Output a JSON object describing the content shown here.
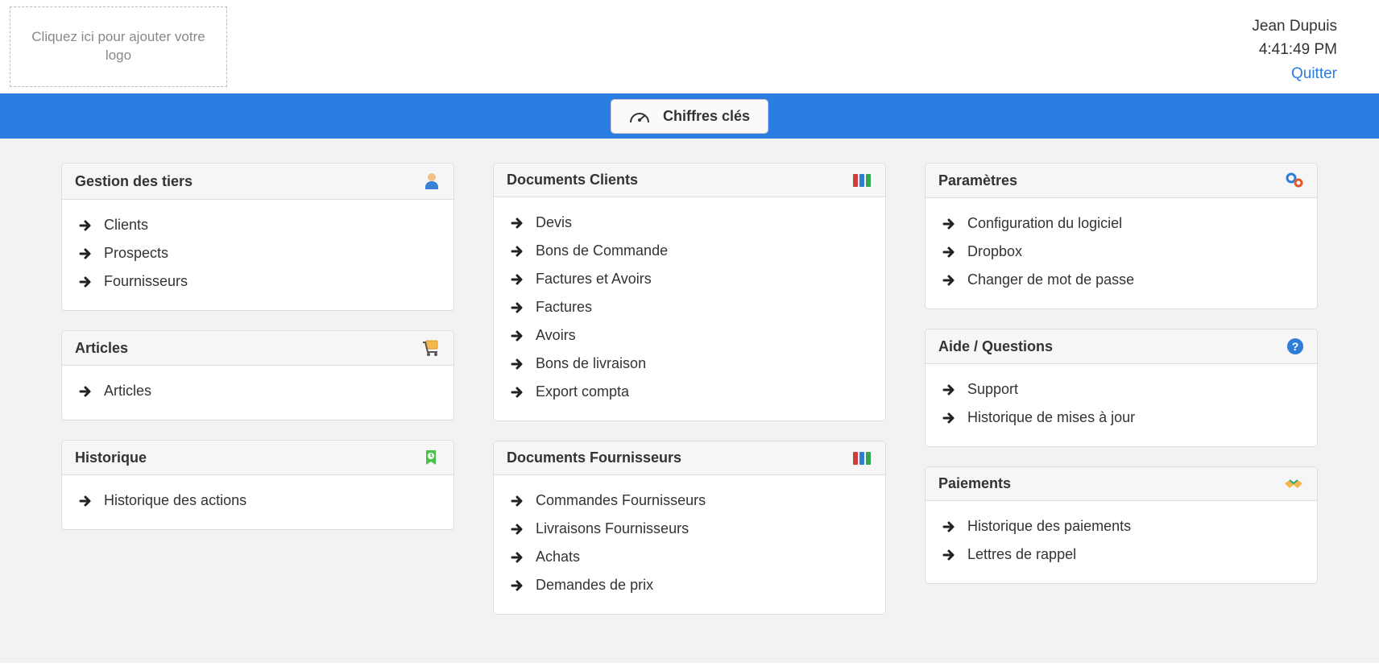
{
  "header": {
    "logo_placeholder": "Cliquez ici pour ajouter votre logo",
    "user_name": "Jean Dupuis",
    "time": "4:41:49 PM",
    "quit": "Quitter"
  },
  "bluebar": {
    "key_figures": "Chiffres clés"
  },
  "panels": {
    "tiers": {
      "title": "Gestion des tiers",
      "items": [
        "Clients",
        "Prospects",
        "Fournisseurs"
      ]
    },
    "articles": {
      "title": "Articles",
      "items": [
        "Articles"
      ]
    },
    "historique": {
      "title": "Historique",
      "items": [
        "Historique des actions"
      ]
    },
    "doc_clients": {
      "title": "Documents Clients",
      "items": [
        "Devis",
        "Bons de Commande",
        "Factures et Avoirs",
        "Factures",
        "Avoirs",
        "Bons de livraison",
        "Export compta"
      ]
    },
    "doc_fournisseurs": {
      "title": "Documents Fournisseurs",
      "items": [
        "Commandes Fournisseurs",
        "Livraisons Fournisseurs",
        "Achats",
        "Demandes de prix"
      ]
    },
    "parametres": {
      "title": "Paramètres",
      "items": [
        "Configuration du logiciel",
        "Dropbox",
        "Changer de mot de passe"
      ]
    },
    "aide": {
      "title": "Aide / Questions",
      "items": [
        "Support",
        "Historique de mises à jour"
      ]
    },
    "paiements": {
      "title": "Paiements",
      "items": [
        "Historique des paiements",
        "Lettres de rappel"
      ]
    }
  }
}
